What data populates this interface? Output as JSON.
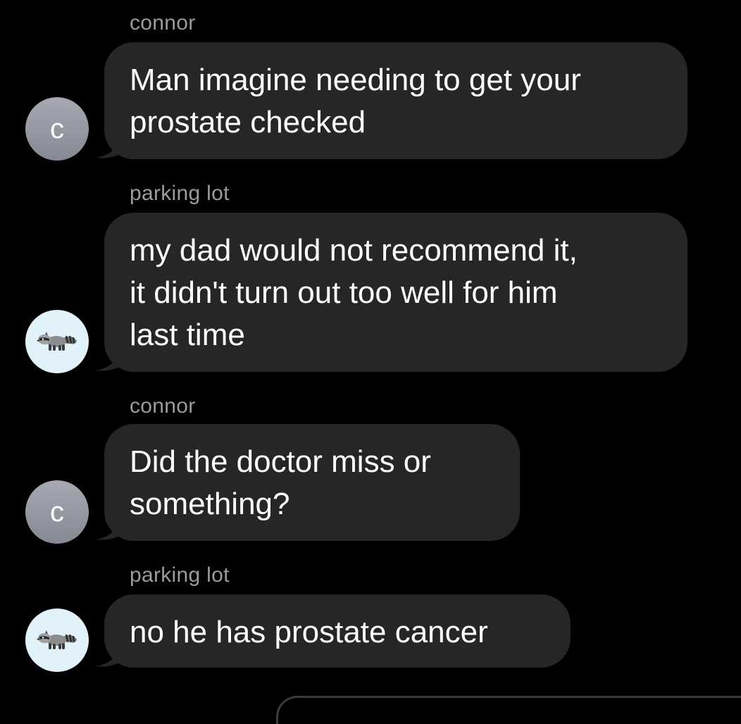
{
  "conversation": {
    "messages": [
      {
        "sender": "connor",
        "avatar": {
          "type": "letter",
          "letter": "C"
        },
        "text": "Man imagine needing to get your\nprostate checked"
      },
      {
        "sender": "parking lot",
        "avatar": {
          "type": "icon",
          "icon": "raccoon-icon"
        },
        "text": "my dad would not recommend it,\nit didn't turn out too well for him\nlast time"
      },
      {
        "sender": "connor",
        "avatar": {
          "type": "letter",
          "letter": "C"
        },
        "text": "Did the doctor miss or\nsomething?"
      },
      {
        "sender": "parking lot",
        "avatar": {
          "type": "icon",
          "icon": "raccoon-icon"
        },
        "text": "no he has prostate cancer"
      }
    ]
  },
  "colors": {
    "background": "#000000",
    "bubble": "#262629",
    "sender_label": "#9a9a9f",
    "letter_avatar": "#8e909b",
    "emoji_avatar": "#e2f2fb"
  }
}
